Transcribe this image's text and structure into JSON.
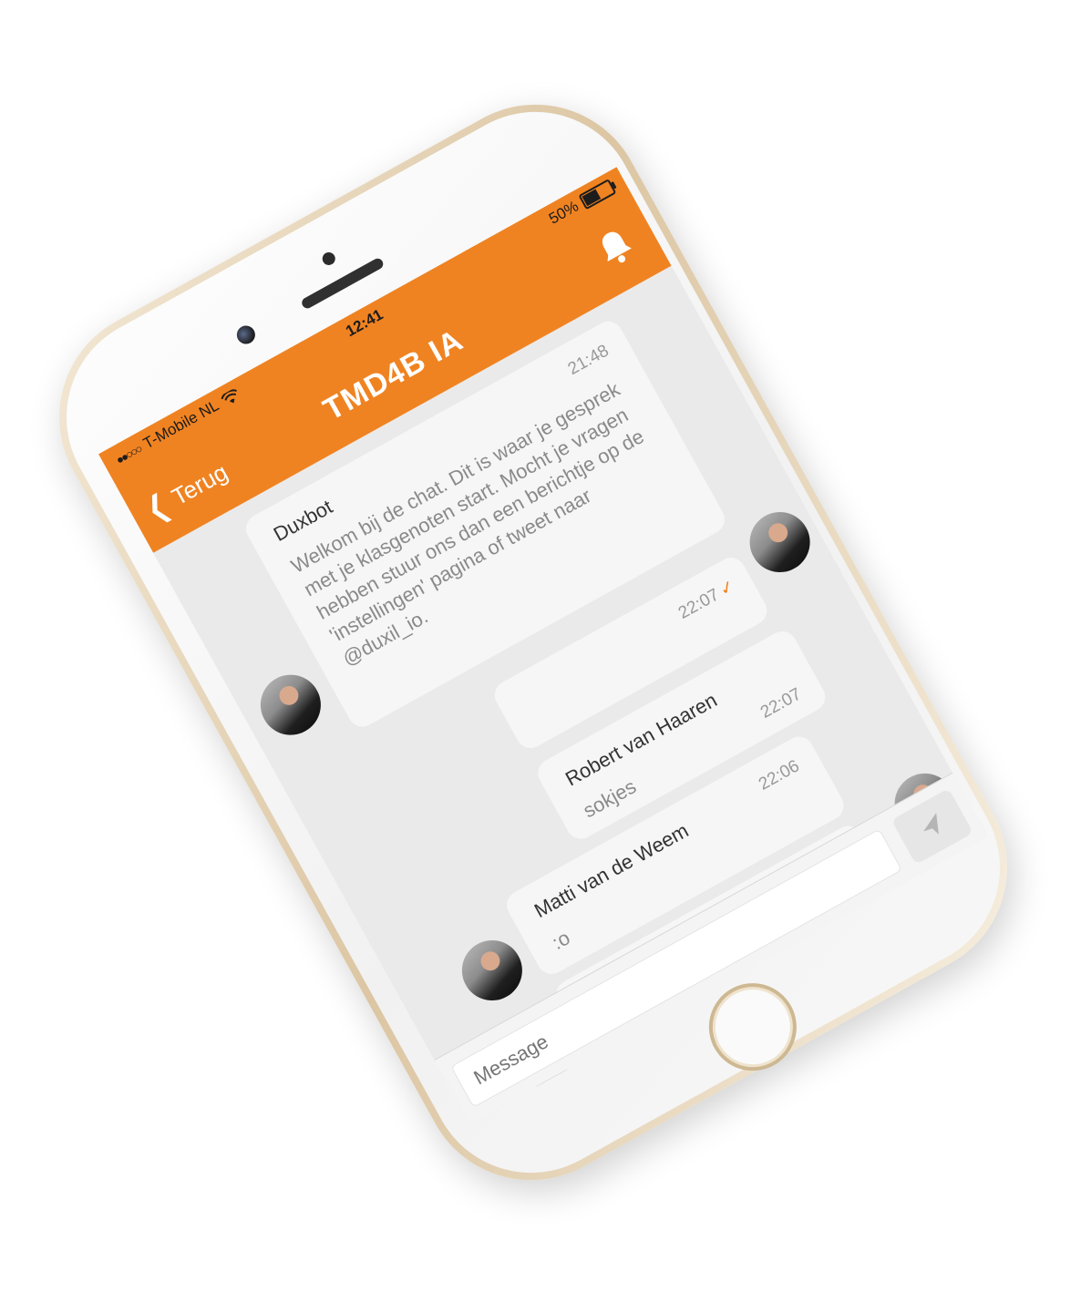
{
  "status_bar": {
    "signal": "●●○○○",
    "carrier": "T-Mobile NL",
    "time": "12:41",
    "battery": "50%",
    "battery_level": 0.5
  },
  "header": {
    "back_label": "Terug",
    "title": "TMD4B IA",
    "background_color": "#f08321"
  },
  "messages": [
    {
      "name": "Duxbot",
      "time": "21:48",
      "text": "Welkom bij de chat. Dit is waar je gesprek met je klasgenoten start. Mocht je vragen hebben stuur ons dan een berichtje op de 'instellingen' pagina of tweet naar @duxil_io.",
      "side": "left"
    },
    {
      "name": "",
      "time": "22:07",
      "text": "",
      "side": "right",
      "delivered": true
    },
    {
      "name": "Robert van Haaren",
      "time": "22:07",
      "text": "sokjes",
      "side": "left"
    },
    {
      "name": "Matti van de Weem",
      "time": "22:06",
      "text": ":o",
      "side": "left"
    },
    {
      "name": "Matti van de Weem",
      "time": "",
      "text": ":')",
      "side": "left"
    }
  ],
  "composer": {
    "placeholder": "Message",
    "send_icon": "send-arrow-icon"
  }
}
